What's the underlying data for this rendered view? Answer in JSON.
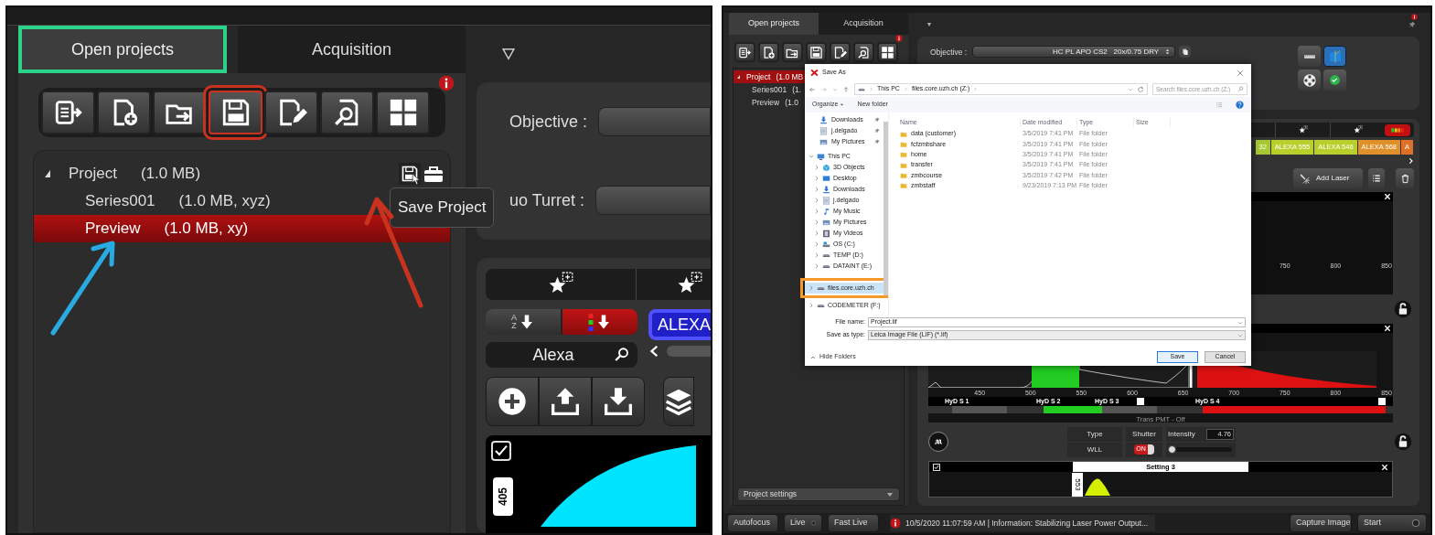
{
  "left": {
    "tabs": [
      {
        "label": "Open projects",
        "selected": true,
        "highlighted": true
      },
      {
        "label": "Acquisition",
        "selected": false,
        "highlighted": false
      }
    ],
    "toolbar": [
      {
        "kind": "export",
        "highlighted": false
      },
      {
        "kind": "new",
        "highlighted": false
      },
      {
        "kind": "open",
        "highlighted": false
      },
      {
        "kind": "save",
        "highlighted": true
      },
      {
        "kind": "edit",
        "highlighted": false
      },
      {
        "kind": "find",
        "highlighted": false
      },
      {
        "kind": "layout",
        "highlighted": false
      }
    ],
    "tree": [
      {
        "label": "Project",
        "size": "(1.0 MB)",
        "expanded": true,
        "selected": false,
        "children": [
          {
            "label": "Series001",
            "size": "(1.0 MB, xyz)",
            "selected": false
          },
          {
            "label": "Preview",
            "size": "(1.0 MB, xy)",
            "selected": true
          }
        ]
      }
    ],
    "tooltip": "Save Project",
    "fields": [
      {
        "label": "Objective :"
      },
      {
        "label": "uo Turret :"
      }
    ],
    "sort_buttons": [
      {
        "kind": "alpha",
        "letters": [
          "A",
          "Z"
        ],
        "selected": false
      },
      {
        "kind": "color",
        "selected": true
      }
    ],
    "dye_tag": "ALEXA",
    "search": {
      "value": "Alexa"
    },
    "action_buttons": [
      {
        "kind": "add"
      },
      {
        "kind": "upload"
      },
      {
        "kind": "download"
      },
      {
        "kind": "layers"
      }
    ],
    "setting": {
      "checked": true,
      "laser_line": "405"
    }
  },
  "right": {
    "tabs": [
      {
        "label": "Open projects",
        "selected": true
      },
      {
        "label": "Acquisition",
        "selected": false
      }
    ],
    "toolbar": [
      {
        "kind": "export",
        "highlighted": false
      },
      {
        "kind": "new",
        "highlighted": false
      },
      {
        "kind": "open",
        "highlighted": false
      },
      {
        "kind": "save",
        "highlighted": false
      },
      {
        "kind": "edit",
        "highlighted": false
      },
      {
        "kind": "find",
        "highlighted": false
      },
      {
        "kind": "layout",
        "highlighted": false
      }
    ],
    "tree": [
      {
        "label": "Project",
        "size": "(1.0 MB",
        "expanded": true,
        "selected": true,
        "children": [
          {
            "label": "Series001",
            "size": "(1.",
            "selected": false
          },
          {
            "label": "Preview",
            "size": "(1.0",
            "selected": false
          }
        ]
      }
    ],
    "project_settings": "Project settings",
    "objective": {
      "label": "Objective :",
      "value": "HC PL APO CS2   20x/0.75 DRY"
    },
    "dye_tags": [
      {
        "label": "32",
        "color": "#a8c832"
      },
      {
        "label": "ALEXA 555",
        "color": "#b9cf2c"
      },
      {
        "label": "ALEXA 546",
        "color": "#b9cf2c"
      },
      {
        "label": "ALEXA 568",
        "color": "#e0902a"
      },
      {
        "label": "A",
        "color": "#e0702a"
      }
    ],
    "add_laser": "Add Laser",
    "spectrum_top": {
      "ticks": [
        "750",
        "800",
        "850"
      ]
    },
    "spectrum": {
      "ticks": [
        "450",
        "500",
        "550",
        "600",
        "650",
        "700",
        "750",
        "800",
        "850"
      ],
      "detectors": [
        {
          "label": "HyD S 1",
          "on": false,
          "color": "#555555"
        },
        {
          "label": "HyD S 2",
          "on": true,
          "color": "#22cc22"
        },
        {
          "label": "HyD S 3",
          "on": false,
          "color": "#555555"
        },
        {
          "label": "HyD S 4",
          "on": true,
          "color": "#dd1111"
        }
      ],
      "footer": "Trans PMT - Off"
    },
    "laser": {
      "type_label": "Type",
      "type": "WLL",
      "shutter_label": "Shutter",
      "shutter_on": true,
      "shutter_text": "ON",
      "intensity_label": "Intensity",
      "intensity": "4.76",
      "level": 0.03
    },
    "setting": {
      "title": "Setting 3",
      "checked": true,
      "laser_line": "553"
    },
    "status_bar": {
      "left_buttons": [
        {
          "label": "Autofocus",
          "kind": "plain"
        },
        {
          "label": "Live",
          "kind": "toggle"
        },
        {
          "label": "Fast Live",
          "kind": "toggle"
        }
      ],
      "message": "10/5/2020 11:07:59 AM | Information: Stabilizing Laser Power Output...",
      "right_buttons": [
        {
          "label": "Capture Image",
          "kind": "toggle"
        },
        {
          "label": "Start",
          "kind": "toggle"
        }
      ]
    },
    "dialog": {
      "title": "Save As",
      "breadcrumb": [
        "This PC",
        "files.core.uzh.ch (Z:)"
      ],
      "search_placeholder": "Search files.core.uzh.ch (Z:)",
      "commands": [
        "Organize",
        "New folder"
      ],
      "nav": [
        {
          "label": "Downloads",
          "kind": "download",
          "pinned": true
        },
        {
          "label": "j.delgado",
          "kind": "user",
          "pinned": true
        },
        {
          "label": "My Pictures",
          "kind": "pictures",
          "pinned": true
        },
        {
          "label": "This PC",
          "kind": "pc",
          "expanded": true,
          "children": [
            {
              "label": "3D Objects",
              "kind": "cube"
            },
            {
              "label": "Desktop",
              "kind": "desktop"
            },
            {
              "label": "Downloads",
              "kind": "download"
            },
            {
              "label": "j.delgado",
              "kind": "user"
            },
            {
              "label": "My Music",
              "kind": "music"
            },
            {
              "label": "My Pictures",
              "kind": "pictures"
            },
            {
              "label": "My Videos",
              "kind": "video"
            },
            {
              "label": "OS (C:)",
              "kind": "os"
            },
            {
              "label": "TEMP (D:)",
              "kind": "drive"
            },
            {
              "label": "DATAINT (E:)",
              "kind": "drive"
            }
          ]
        },
        {
          "label": "files.core.uzh.ch",
          "kind": "drive",
          "expanded": false,
          "selected": true,
          "highlighted": true
        },
        {
          "label": "CODEMETER (F:)",
          "kind": "drive",
          "expanded": false,
          "selected": false,
          "highlighted": false
        }
      ],
      "columns": [
        "Name",
        "Date modified",
        "Type",
        "Size"
      ],
      "rows": [
        {
          "name": "data (customer)",
          "date": "3/5/2019 7:41 PM",
          "type": "File folder"
        },
        {
          "name": "fcfzmbshare",
          "date": "3/5/2019 7:41 PM",
          "type": "File folder"
        },
        {
          "name": "home",
          "date": "3/5/2019 7:41 PM",
          "type": "File folder"
        },
        {
          "name": "transfer",
          "date": "3/5/2019 7:41 PM",
          "type": "File folder"
        },
        {
          "name": "zmbcourse",
          "date": "3/5/2019 7:42 PM",
          "type": "File folder"
        },
        {
          "name": "zmbstaff",
          "date": "9/23/2019 7:13 PM",
          "type": "File folder"
        }
      ],
      "file_name": {
        "label": "File name:",
        "value": "Project.lif"
      },
      "save_type": {
        "label": "Save as type:",
        "value": "Leica Image File (LIF) (*.lif)"
      },
      "hide_folders": "Hide Folders",
      "buttons": [
        "Save",
        "Cancel"
      ]
    }
  }
}
